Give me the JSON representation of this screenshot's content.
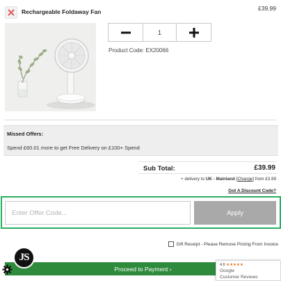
{
  "product": {
    "name": "Rechargeable Foldaway Fan",
    "price": "£39.99",
    "quantity": "1",
    "code_text": "Product Code: EX20066"
  },
  "missed_offers": {
    "title": "Missed Offers:",
    "text": "Spend £60.01 more to get Free Delivery on £100+ Spend"
  },
  "summary": {
    "subtotal_label": "Sub Total:",
    "subtotal_value": "£39.99",
    "delivery_prefix": "+ delivery to",
    "delivery_region": "UK - Mainland",
    "change_label": "Change",
    "delivery_suffix": "from £3.99",
    "discount_link": "Got A Discount Code?"
  },
  "offer": {
    "placeholder": "Enter Offer Code...",
    "apply_label": "Apply"
  },
  "gift_receipt_label": "Gift Receipt - Please Remove Pricing From Invoice",
  "proceed_label": "Proceed to Payment ›",
  "badge_text": "JS",
  "reviews": {
    "rating": "4.6",
    "stars": "★★★★★",
    "brand": "Google",
    "subtitle": "Customer Reviews"
  },
  "colors": {
    "accent_green": "#27ae60",
    "proceed_green": "#2f8b3c",
    "apply_grey": "#a9a9a9",
    "remove_red": "#e05a5a",
    "star_orange": "#e7711b"
  },
  "icons": {
    "remove": "close-icon",
    "minus": "minus-icon",
    "plus": "plus-icon",
    "settings": "gear-icon"
  }
}
